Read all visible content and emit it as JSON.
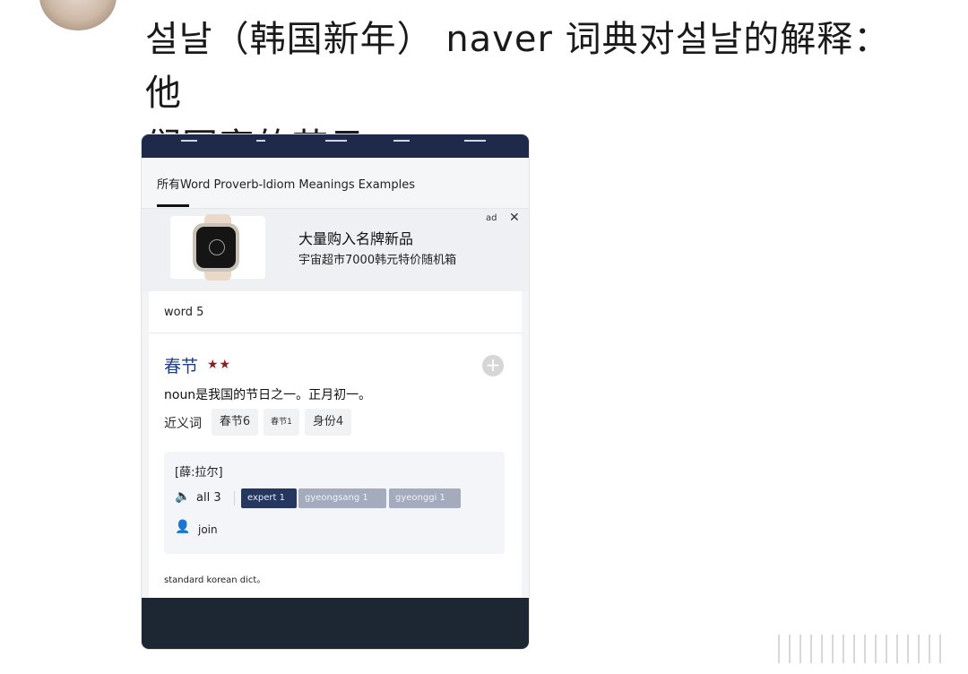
{
  "post": {
    "title_line1": "설날（韩国新年） naver 词典对설날的解释： 他",
    "title_line2": "们国家的节日"
  },
  "dictionary": {
    "tabs_label": "所有Word Proverb-ldiom Meanings Examples",
    "ad": {
      "tag": "ad",
      "close": "✕",
      "headline": "大量购入名牌新品",
      "subline": "宇宙超市7000韩元特价随机箱"
    },
    "word_count": "word 5",
    "entry": {
      "headword": "春节",
      "stars": "★★",
      "add": "+",
      "definition": "noun是我国的节日之一。正月初一。",
      "synonyms_label": "近义词",
      "synonyms": [
        "春节6",
        "春节1",
        "身份4"
      ],
      "pronunciation": "[薛:拉尔]",
      "speaker_icon": "speaker-icon",
      "audio_all": "all 3",
      "audio_badges": [
        "expert 1",
        "gyeongsang 1",
        "gyeonggi 1"
      ],
      "join_icon": "person-join-icon",
      "join": "join",
      "source": "standard korean dict。"
    }
  },
  "colors": {
    "nav_bar": "#1f2a4a",
    "bottom_bar": "#1c2733",
    "headword": "#1d3f8f",
    "stars": "#8b1e1e",
    "badge_active": "#26375f",
    "badge_inactive": "#a3abbd"
  }
}
